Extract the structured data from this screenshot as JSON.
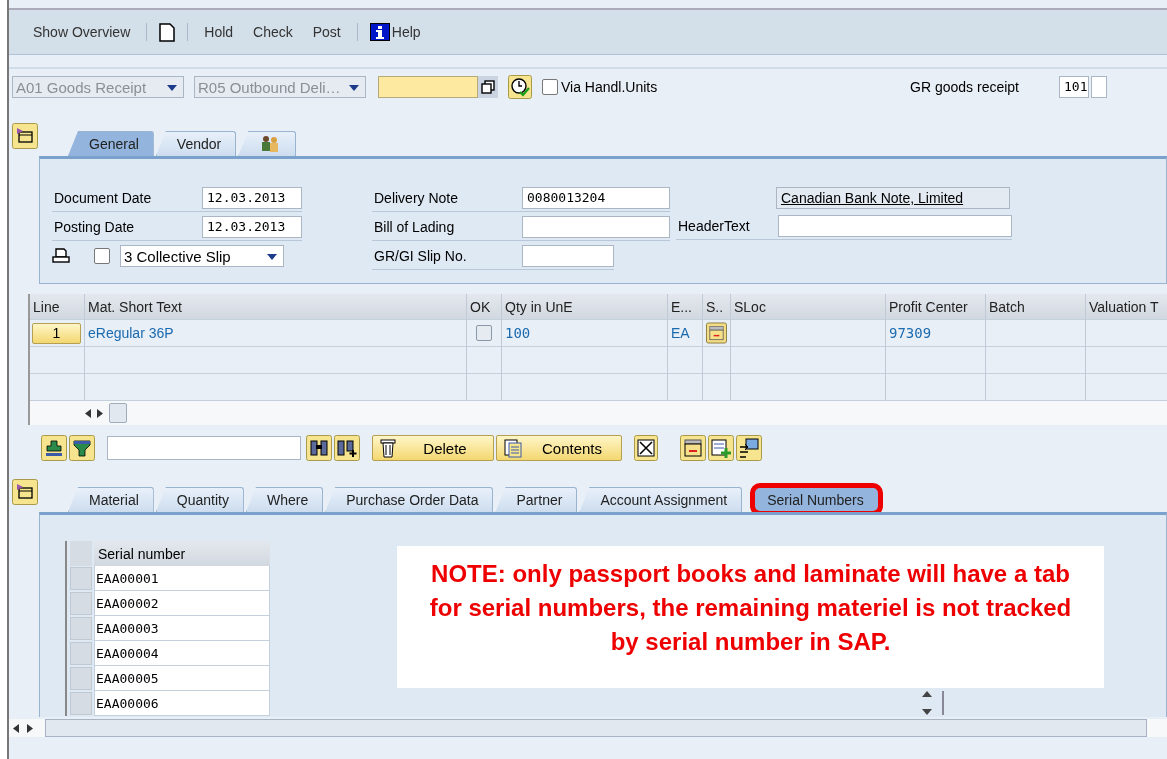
{
  "toolbar": {
    "groups": [
      [
        {
          "kind": "text",
          "label": "Show Overview"
        }
      ],
      [
        {
          "kind": "document"
        }
      ],
      [
        {
          "kind": "text",
          "label": "Hold"
        },
        {
          "kind": "text",
          "label": "Check"
        },
        {
          "kind": "text",
          "label": "Post"
        }
      ],
      [
        {
          "kind": "help",
          "label": "Help"
        }
      ]
    ]
  },
  "selection": {
    "action": {
      "value": "A01 Goods Receipt",
      "disabled": true
    },
    "reference": {
      "value": "R05 Outbound Deli…",
      "disabled": true
    },
    "via_handling_units": {
      "label": "Via Handl.Units",
      "checked": false
    },
    "movement_label": "GR goods receipt",
    "movement_type": "101"
  },
  "header_tabs": [
    {
      "kind": "text",
      "label": "General",
      "selected": true
    },
    {
      "kind": "text",
      "label": "Vendor",
      "selected": false
    },
    {
      "kind": "people",
      "selected": false
    }
  ],
  "header": {
    "document_date": {
      "label": "Document Date",
      "value": "12.03.2013"
    },
    "posting_date": {
      "label": "Posting Date",
      "value": "12.03.2013"
    },
    "print": {
      "checked": false,
      "slip": "3 Collective Slip"
    },
    "delivery_note": {
      "label": "Delivery Note",
      "value": "0080013204"
    },
    "bill_of_lading": {
      "label": "Bill of Lading"
    },
    "slip_no": {
      "label": "GR/GI Slip No."
    },
    "vendor_name": "Canadian Bank Note, Limited",
    "header_text": {
      "label": "HeaderText"
    }
  },
  "items": {
    "columns": [
      "Line",
      "Mat. Short Text",
      "OK",
      "Qty in UnE",
      "E...",
      "S..",
      "SLoc",
      "Profit Center",
      "Batch",
      "Valuation T"
    ],
    "rows": [
      {
        "line": "1",
        "text": "eRegular 36P",
        "ok": false,
        "qty": "100",
        "unit": "EA",
        "profit_center": "97309"
      }
    ]
  },
  "item_toolbar": {
    "delete": "Delete",
    "contents": "Contents"
  },
  "detail_tabs": [
    {
      "label": "Material",
      "selected": false,
      "highlighted": false
    },
    {
      "label": "Quantity",
      "selected": false,
      "highlighted": false
    },
    {
      "label": "Where",
      "selected": false,
      "highlighted": false
    },
    {
      "label": "Purchase Order Data",
      "selected": false,
      "highlighted": false
    },
    {
      "label": "Partner",
      "selected": false,
      "highlighted": false
    },
    {
      "label": "Account Assignment",
      "selected": false,
      "highlighted": false
    },
    {
      "label": "Serial Numbers",
      "selected": true,
      "highlighted": true
    }
  ],
  "serials": {
    "header": "Serial number",
    "rows": [
      "EAA00001",
      "EAA00002",
      "EAA00003",
      "EAA00004",
      "EAA00005",
      "EAA00006"
    ]
  },
  "note": "NOTE: only passport books and laminate will have a tab for serial numbers, the remaining materiel is not tracked by serial number in SAP."
}
